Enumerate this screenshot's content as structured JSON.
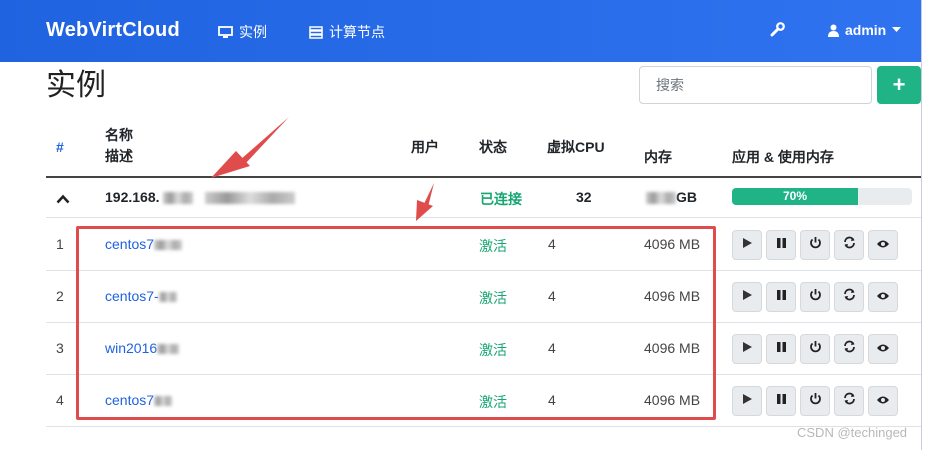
{
  "navbar": {
    "brand": "WebVirtCloud",
    "instances_label": "实例",
    "nodes_label": "计算节点",
    "user_label": "admin"
  },
  "page": {
    "title": "实例",
    "search_placeholder": "搜索",
    "add_label": "+"
  },
  "table": {
    "headers": {
      "num": "#",
      "name": "名称",
      "desc": "描述",
      "user": "用户",
      "status": "状态",
      "vcpu": "虚拟CPU",
      "memory": "内存",
      "apps": "应用 & 使用内存"
    },
    "host": {
      "expand_glyph": "^",
      "name": "192.168.",
      "status": "已连接",
      "cpu": "32",
      "memory_suffix": "GB",
      "usage_percent": 70,
      "usage_label": "70%"
    },
    "rows": [
      {
        "num": "1",
        "name": "centos7",
        "status": "激活",
        "cpu": "4",
        "memory": "4096 MB"
      },
      {
        "num": "2",
        "name": "centos7-",
        "status": "激活",
        "cpu": "4",
        "memory": "4096 MB"
      },
      {
        "num": "3",
        "name": "win2016",
        "status": "激活",
        "cpu": "4",
        "memory": "4096 MB"
      },
      {
        "num": "4",
        "name": "centos7",
        "status": "激活",
        "cpu": "4",
        "memory": "4096 MB"
      }
    ]
  },
  "watermark": "CSDN @techinged",
  "colors": {
    "navbar": "#1f63e0",
    "success": "#20b386",
    "status_text": "#17a673",
    "link": "#1f63e0",
    "annotation": "#e04b4b"
  },
  "icons": {
    "instances": "monitor-icon",
    "nodes": "server-icon",
    "settings": "wrench-icon",
    "user": "user-icon",
    "actions": [
      "play-icon",
      "pause-icon",
      "power-icon",
      "refresh-icon",
      "eye-icon"
    ]
  }
}
